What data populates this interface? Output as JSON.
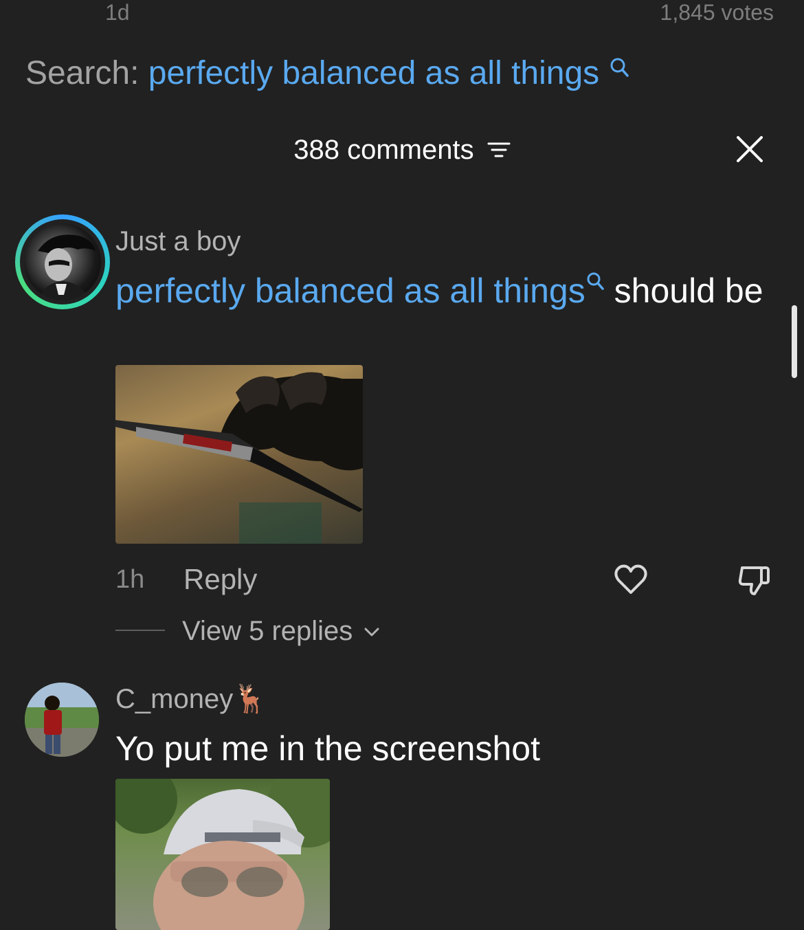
{
  "meta": {
    "time": "1d",
    "votes": "1,845 votes"
  },
  "search": {
    "label": "Search:",
    "term": "perfectly balanced as all things"
  },
  "header": {
    "comments_count": "388 comments"
  },
  "comments": [
    {
      "author": "Just a boy",
      "body_link": "perfectly balanced as all things",
      "body_rest": "should be",
      "time": "1h",
      "reply_label": "Reply",
      "view_replies": "View 5 replies"
    },
    {
      "author": "C_money",
      "author_emoji": "🦌",
      "body": "Yo put me in the screenshot"
    }
  ],
  "colors": {
    "background": "#212121",
    "link": "#5aa9f0",
    "muted": "#b3b3b3"
  }
}
